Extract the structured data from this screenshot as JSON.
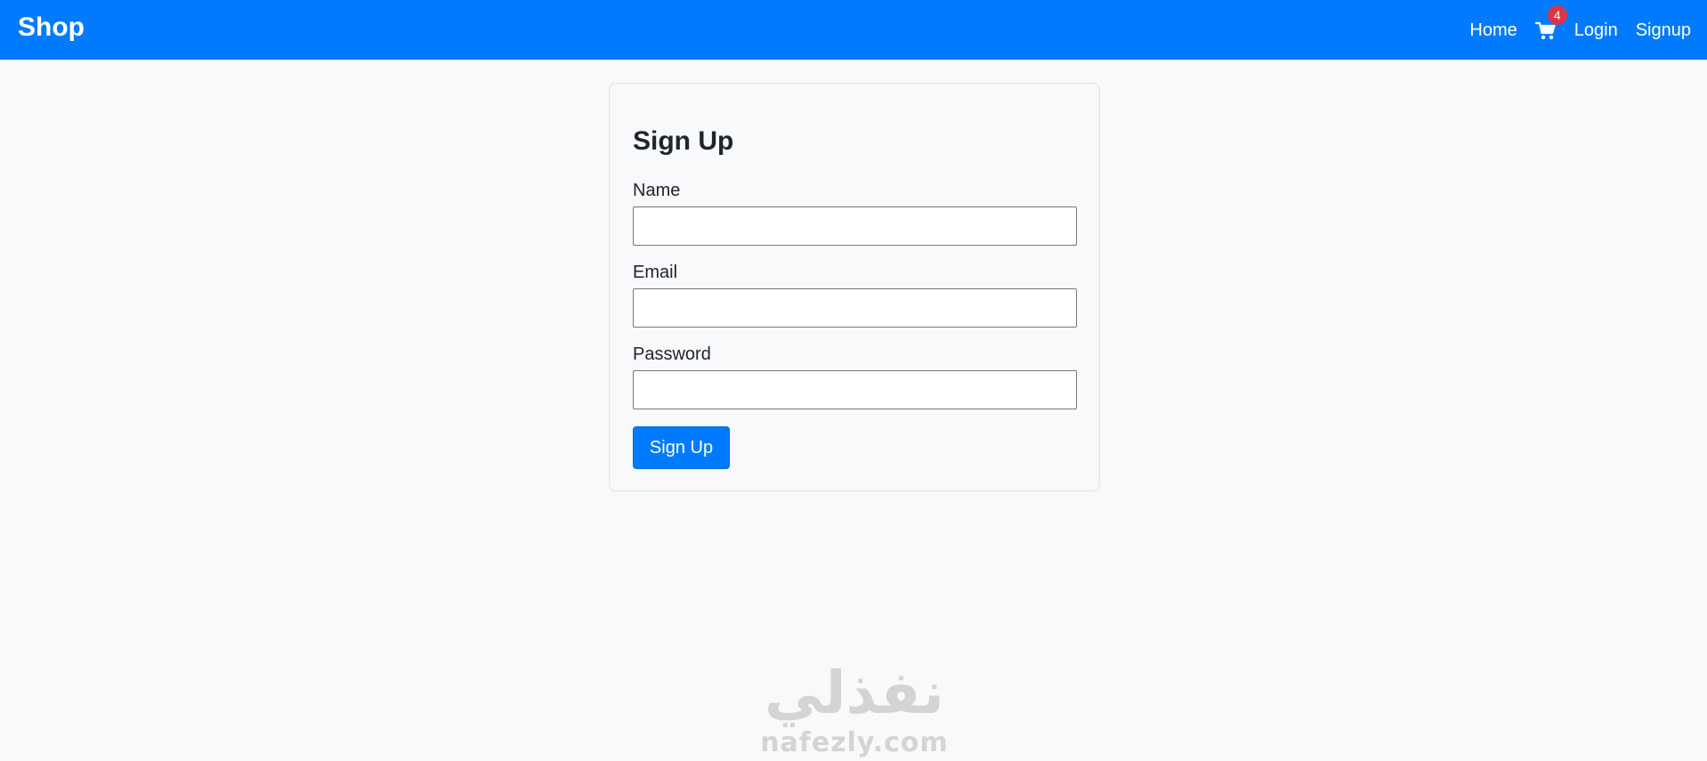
{
  "colors": {
    "navbar_background": "#007bff",
    "page_background": "#f8f9fa",
    "primary_button": "#007bff",
    "badge": "#dc3545",
    "text": "#212529"
  },
  "navbar": {
    "brand": "Shop",
    "links": {
      "home": "Home",
      "login": "Login",
      "signup": "Signup"
    },
    "cart": {
      "icon": "shopping-cart-icon",
      "badge_count": "4"
    }
  },
  "signup_form": {
    "title": "Sign Up",
    "fields": {
      "name": {
        "label": "Name",
        "value": "",
        "placeholder": ""
      },
      "email": {
        "label": "Email",
        "value": "",
        "placeholder": ""
      },
      "password": {
        "label": "Password",
        "value": "",
        "placeholder": ""
      }
    },
    "submit_label": "Sign Up"
  },
  "watermark": {
    "arabic_text": "نفذلي",
    "latin_text": "nafezly.com"
  }
}
